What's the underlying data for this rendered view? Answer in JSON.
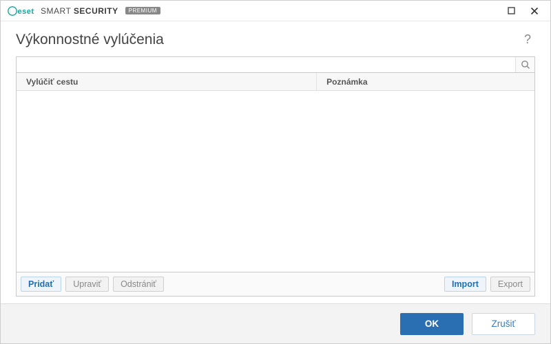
{
  "titlebar": {
    "brand_prefix": "SMART",
    "brand_suffix": "SECURITY",
    "brand_badge": "PREMIUM"
  },
  "header": {
    "title": "Výkonnostné vylúčenia"
  },
  "search": {
    "value": "",
    "placeholder": ""
  },
  "table": {
    "columns": {
      "path": "Vylúčiť cestu",
      "note": "Poznámka"
    },
    "rows": []
  },
  "actions": {
    "add": "Pridať",
    "edit": "Upraviť",
    "delete": "Odstrániť",
    "import": "Import",
    "export": "Export"
  },
  "footer": {
    "ok": "OK",
    "cancel": "Zrušiť"
  }
}
